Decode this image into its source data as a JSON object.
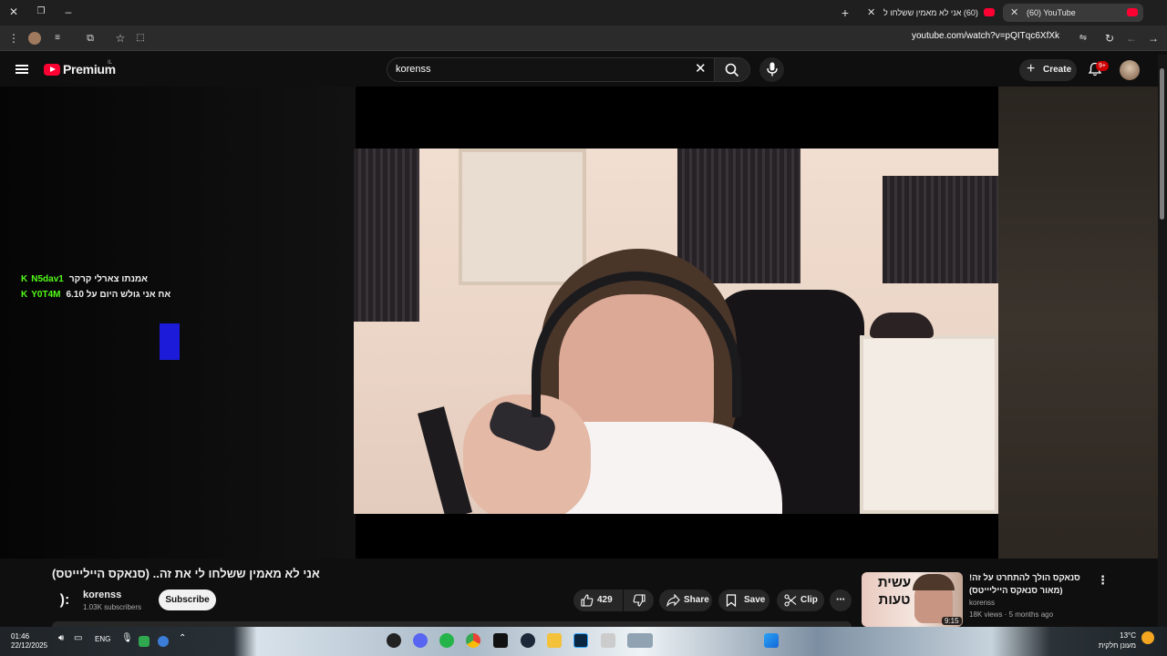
{
  "browser": {
    "tabs": [
      {
        "title": "(60) YouTube",
        "active": true
      },
      {
        "title": "(60) אני לא מאמין ששלחו ל",
        "active": false
      }
    ],
    "url": "youtube.com/watch?v=pQITqc6XfXk"
  },
  "header": {
    "logo_text": "Premium",
    "region": "IL",
    "search_value": "korenss",
    "create_label": "Create",
    "notification_count": "9+"
  },
  "player": {
    "chat": [
      {
        "user": "N5dav1",
        "message": "אמנתו צארלי קרקר"
      },
      {
        "user": "Y0T4M",
        "message": "אח אני גולש היום על 6.10"
      }
    ],
    "watermark": "):"
  },
  "video": {
    "title": "אני לא מאמין ששלחו לי את זה.. (סנאקס הייליייטס)",
    "channel_avatar": "):",
    "channel_name": "korenss",
    "subscribers": "1.03K subscribers",
    "subscribe_label": "Subscribe",
    "likes": "429",
    "share_label": "Share",
    "save_label": "Save",
    "clip_label": "Clip",
    "more_label": "⋯"
  },
  "recommendation": {
    "thumb_text": "עשית טעות",
    "duration": "9:15",
    "title": "סנאקס הולך להתחרט על זה! (מאור סנאקס הייליייטס)",
    "channel": "korenss",
    "meta": "18K views · 5 months ago"
  },
  "taskbar": {
    "time": "01:46",
    "date": "22/12/2025",
    "lang": "ENG",
    "weather_temp": "13°C",
    "weather_desc": "מעונן חלקית"
  },
  "colors": {
    "accent": "#ff0033",
    "chat_name": "#53fc18",
    "bg": "#0f0f0f"
  }
}
